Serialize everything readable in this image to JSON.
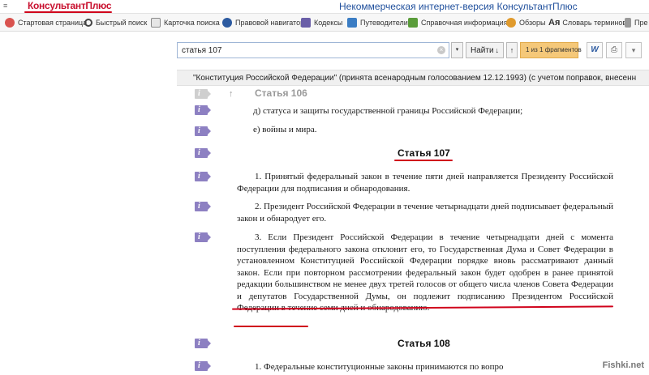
{
  "titlebar": {
    "menu_icon": "≡",
    "logo": "КонсультантПлюс",
    "title": "Некоммерческая интернет-версия КонсультантПлюс"
  },
  "toolbar": {
    "items": [
      {
        "label": "Стартовая страница",
        "icon": "home-icon",
        "color": "#d9534f"
      },
      {
        "label": "Быстрый поиск",
        "icon": "search-icon",
        "color": "#444444"
      },
      {
        "label": "Карточка поиска",
        "icon": "search-card-icon",
        "color": "#6b6b6b"
      },
      {
        "label": "Правовой навигатор",
        "icon": "navigator-icon",
        "color": "#2c5aa0"
      },
      {
        "label": "Кодексы",
        "icon": "codes-icon",
        "color": "#6a5fa8"
      },
      {
        "label": "Путеводители",
        "icon": "guides-icon",
        "color": "#3b7dc4"
      },
      {
        "label": "Справочная информация",
        "icon": "reference-icon",
        "color": "#5a9c3a"
      },
      {
        "label": "Обзоры",
        "icon": "reviews-icon",
        "color": "#e09a2c"
      },
      {
        "label": "Словарь терминов",
        "icon": "dictionary-icon",
        "color": "#333333"
      },
      {
        "label": "Пре",
        "icon": "press-icon",
        "color": "#777777"
      }
    ]
  },
  "search": {
    "value": "статья 107",
    "clear": "×",
    "dropdown": "▾",
    "find_label": "Найти",
    "find_arrow": "↓",
    "up_arrow": "↑",
    "fragments": "1 из 1 фрагментов"
  },
  "actions": {
    "word": "W",
    "print": "⎙",
    "more": "▾"
  },
  "document": {
    "header": "\"Конституция Российской Федерации\" (принята всенародным голосованием 12.12.1993) (с учетом поправок, внесенн",
    "up_arrow": "↑",
    "prev_article": "Статья 106",
    "line_d": "д) статуса и защиты государственной границы Российской Федерации;",
    "line_e": "е) войны и мира.",
    "article_107_title": "Статья 107",
    "p1": "1. Принятый федеральный закон в течение пяти дней направляется Президенту Российской Федерации для подписания и обнародования.",
    "p2": "2. Президент Российской Федерации в течение четырнадцати дней подписывает федеральный закон и обнародует его.",
    "p3": "3. Если Президент Российской Федерации в течение четырнадцати дней с момента поступления федерального закона отклонит его, то Государственная Дума и Совет Федерации в установленном Конституцией Российской Федерации порядке вновь рассматривают данный закон. Если при повторном рассмотрении федеральный закон будет одобрен в ранее принятой редакции большинством не менее двух третей голосов от общего числа членов Совета Федерации и депутатов Государственной Думы, он подлежит подписанию Президентом Российской Федерации в течение семи дней и обнародованию.",
    "article_108_title": "Статья 108",
    "p108_1": "1. Федеральные конституционные законы принимаются по вопро",
    "info_icon": "i"
  },
  "watermark": "Fishki.net",
  "colors": {
    "brand_red": "#c8102e",
    "title_blue": "#1f4f9c",
    "fragment_orange": "#f5c879",
    "info_purple": "#8d80c2",
    "annotation_red": "#d0021b"
  }
}
